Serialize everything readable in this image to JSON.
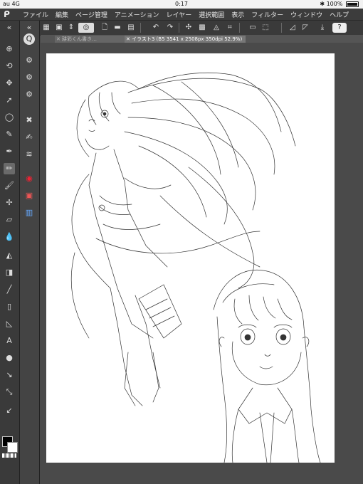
{
  "status": {
    "carrier": "au",
    "network": "4G",
    "time": "0:17",
    "battery": "100%"
  },
  "menu": [
    "ファイル",
    "編集",
    "ページ管理",
    "アニメーション",
    "レイヤー",
    "選択範囲",
    "表示",
    "フィルター",
    "ウィンドウ",
    "ヘルプ"
  ],
  "tabs": [
    {
      "label": "耕彩くん書き…"
    },
    {
      "label": "イラスト3 (B5 3541 x 2508px 350dpi 52.9%)"
    }
  ],
  "colors": {
    "foreground": "#000000",
    "background": "#ffffff"
  }
}
